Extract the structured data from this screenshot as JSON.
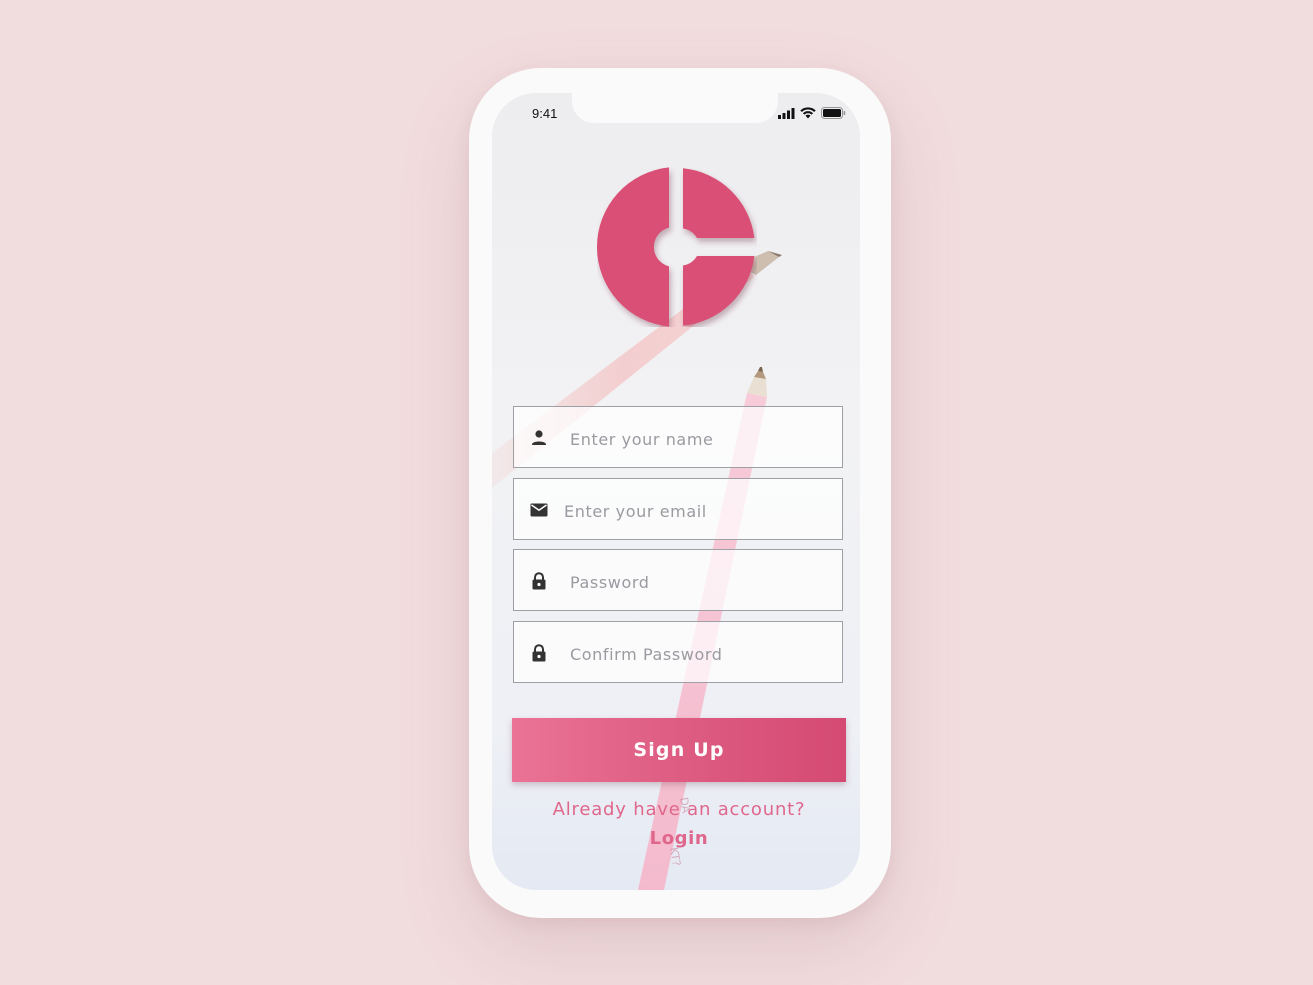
{
  "status_bar": {
    "time": "9:41",
    "icons": [
      "cellular-signal-icon",
      "wifi-icon",
      "battery-icon"
    ]
  },
  "logo": {
    "icon": "brand-logo-icon",
    "color": "#d94f74"
  },
  "form": {
    "fields": [
      {
        "icon": "person-icon",
        "placeholder": "Enter your name",
        "value": ""
      },
      {
        "icon": "envelope-icon",
        "placeholder": "Enter your email",
        "value": ""
      },
      {
        "icon": "lock-icon",
        "placeholder": "Password",
        "value": ""
      },
      {
        "icon": "lock-icon",
        "placeholder": "Confirm Password",
        "value": ""
      }
    ],
    "submit_label": "Sign Up"
  },
  "footer": {
    "prompt": "Already have an account?",
    "login_label": "Login"
  },
  "colors": {
    "accent": "#e0678c",
    "button_start": "#ea7396",
    "button_end": "#d44a72",
    "background": "#f1dcde"
  }
}
